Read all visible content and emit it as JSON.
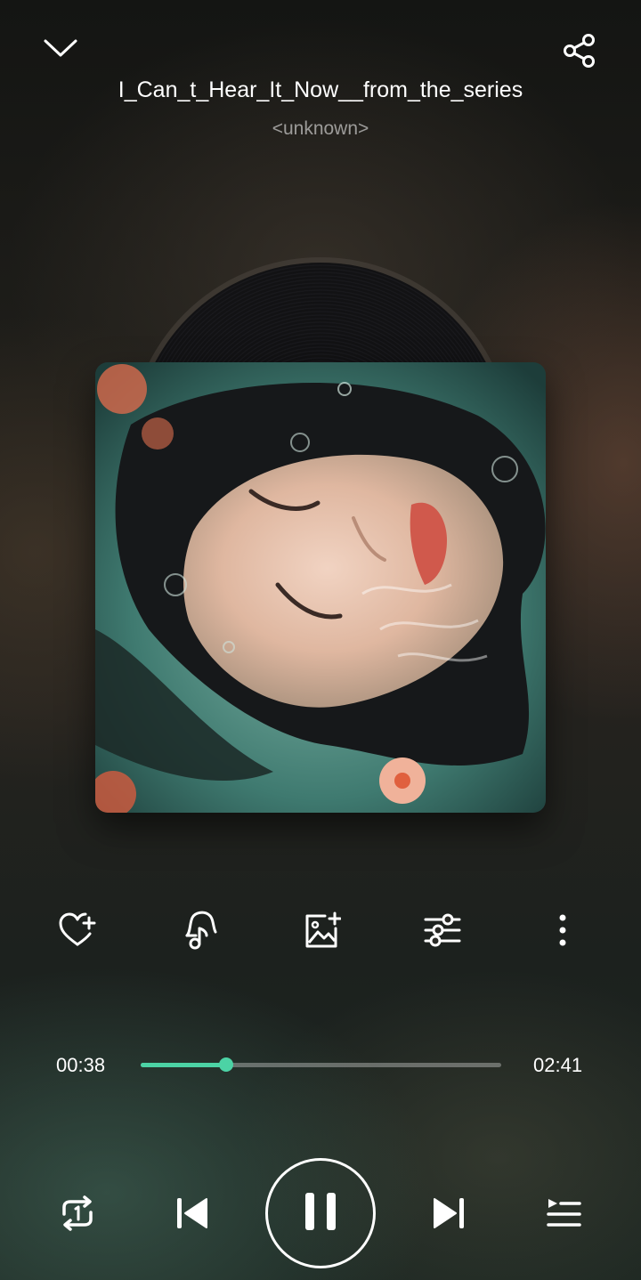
{
  "header": {
    "collapse_icon": "chevron-down-icon",
    "share_icon": "share-icon"
  },
  "track": {
    "title": "I_Can_t_Hear_It_Now__from_the_series",
    "artist": "<unknown>"
  },
  "artwork": {
    "description_icon": "album-art"
  },
  "actions": {
    "favorite_icon": "heart-plus-icon",
    "ringtone_icon": "bell-music-icon",
    "cover_icon": "image-add-icon",
    "equalizer_icon": "sliders-icon",
    "more_icon": "more-vertical-icon"
  },
  "playback": {
    "current_time": "00:38",
    "total_time": "02:41",
    "progress_fraction": 0.236
  },
  "controls": {
    "repeat_icon": "repeat-one-icon",
    "previous_icon": "skip-previous-icon",
    "pause_icon": "pause-icon",
    "next_icon": "skip-next-icon",
    "queue_icon": "playlist-icon"
  },
  "colors": {
    "accent": "#4cd3a5",
    "text_primary": "#ffffff",
    "text_secondary": "#9a9a96"
  }
}
